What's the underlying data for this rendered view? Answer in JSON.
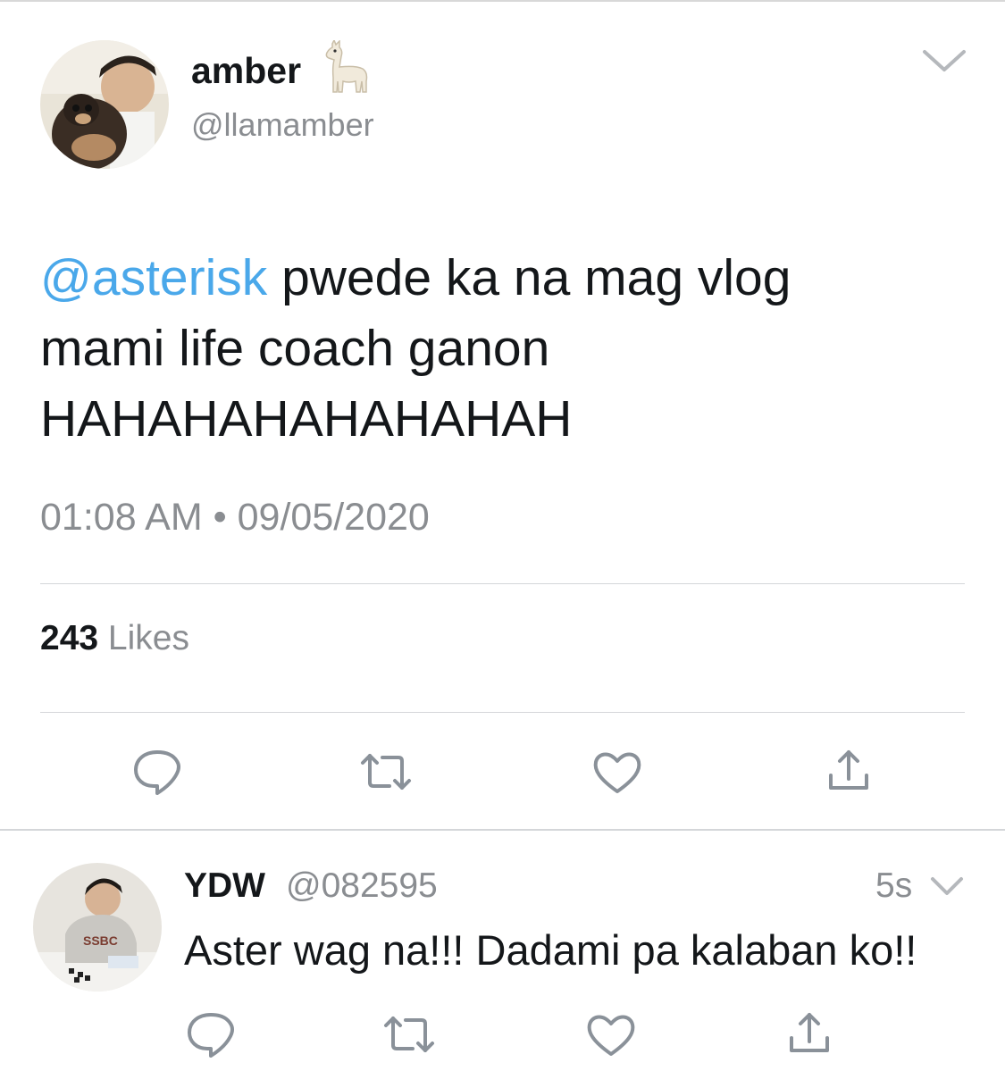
{
  "tweet": {
    "display_name": "amber",
    "name_emoji": "llama-icon",
    "handle": "@llamamber",
    "mention": "@asterisk",
    "text_line1": " pwede ka na mag vlog",
    "text_line2": "mami life coach ganon",
    "text_line3": "HAHAHAHAHAHAHAH",
    "timestamp": "01:08 AM • 09/05/2020",
    "likes_count": "243",
    "likes_label": "Likes"
  },
  "reply": {
    "display_name": "YDW",
    "handle": "@082595",
    "time": "5s",
    "text": "Aster wag na!!! Dadami pa kalaban ko!!"
  },
  "colors": {
    "mention": "#4aa8ea",
    "secondary_text": "#8a8d91",
    "primary_text": "#14171a",
    "divider": "#d4d6d9"
  },
  "icons": [
    "chevron-down-icon",
    "reply-icon",
    "retweet-icon",
    "heart-icon",
    "share-icon"
  ]
}
